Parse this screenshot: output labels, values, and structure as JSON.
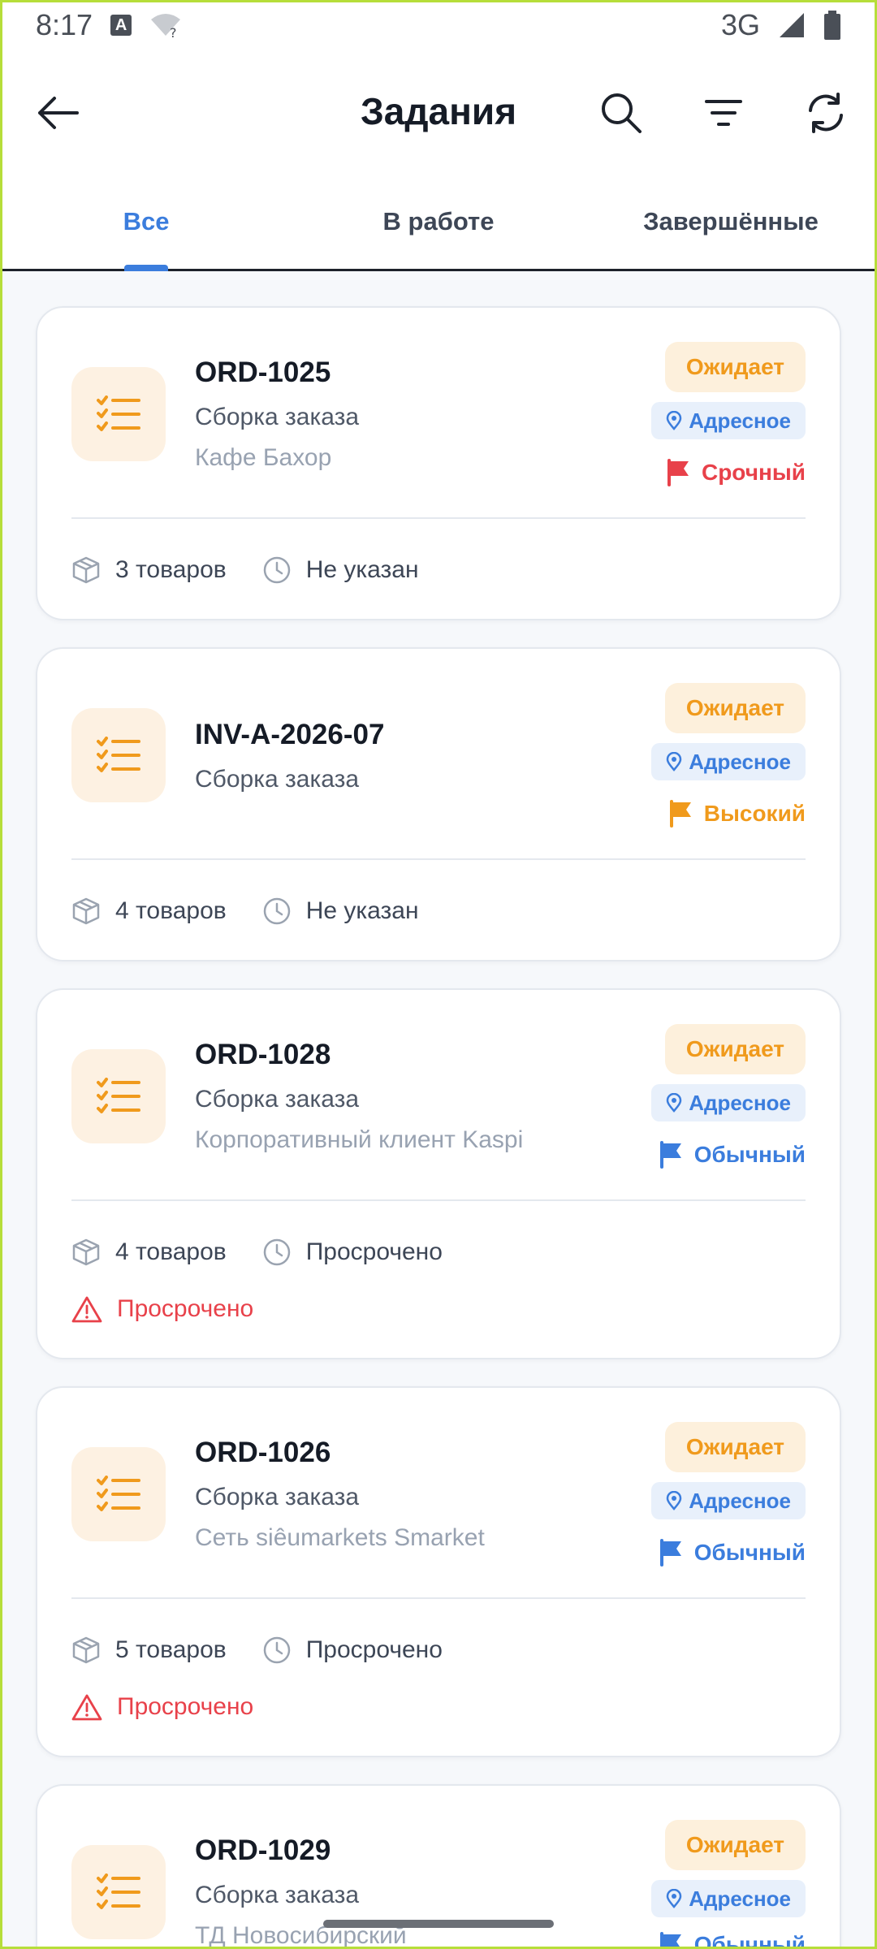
{
  "status_bar": {
    "time": "8:17",
    "network": "3G"
  },
  "header": {
    "title": "Задания"
  },
  "tabs": [
    {
      "label": "Все",
      "active": true
    },
    {
      "label": "В работе",
      "active": false
    },
    {
      "label": "Завершённые",
      "active": false
    }
  ],
  "colors": {
    "accent": "#3b7ddd",
    "pending": "#f09a1c",
    "urgent": "#e8414a",
    "high": "#f09a1c",
    "normal": "#3b7ddd"
  },
  "tasks": [
    {
      "id": "ORD-1025",
      "type": "Сборка заказа",
      "client": "Кафе Бахор",
      "status": "Ожидает",
      "kind": "Адресное",
      "priority": "Срочный",
      "priority_icon": "flag-icon-red",
      "items": "3 товаров",
      "deadline": "Не указан",
      "overdue": ""
    },
    {
      "id": "INV-A-2026-07",
      "type": "Сборка заказа",
      "client": "",
      "status": "Ожидает",
      "kind": "Адресное",
      "priority": "Высокий",
      "priority_icon": "flag-icon-orange",
      "items": "4 товаров",
      "deadline": "Не указан",
      "overdue": ""
    },
    {
      "id": "ORD-1028",
      "type": "Сборка заказа",
      "client": "Корпоративный клиент Kaspi",
      "status": "Ожидает",
      "kind": "Адресное",
      "priority": "Обычный",
      "priority_icon": "flag-icon-blue",
      "items": "4 товаров",
      "deadline": "Просрочено",
      "overdue": "Просрочено"
    },
    {
      "id": "ORD-1026",
      "type": "Сборка заказа",
      "client": "Сеть siêumarkets Smarket",
      "status": "Ожидает",
      "kind": "Адресное",
      "priority": "Обычный",
      "priority_icon": "flag-icon-blue",
      "items": "5 товаров",
      "deadline": "Просрочено",
      "overdue": "Просрочено"
    },
    {
      "id": "ORD-1029",
      "type": "Сборка заказа",
      "client": "ТД Новосибирский",
      "status": "Ожидает",
      "kind": "Адресное",
      "priority": "Обычный",
      "priority_icon": "flag-icon-blue",
      "items": "",
      "deadline": "",
      "overdue": ""
    }
  ]
}
